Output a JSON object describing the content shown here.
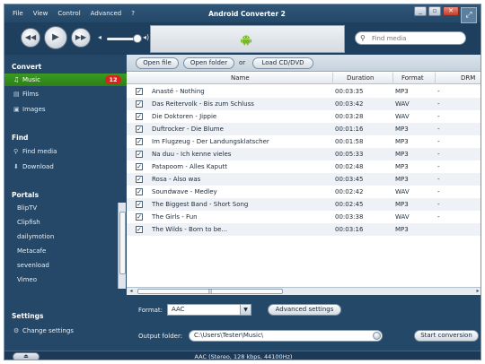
{
  "menu": [
    "File",
    "View",
    "Control",
    "Advanced",
    "?"
  ],
  "app_title": "Android Converter 2",
  "window_buttons": {
    "minimize": "_",
    "restore": "▫",
    "close": "✕",
    "expand": "⤢"
  },
  "player": {
    "rewind": "◀◀",
    "play": "▶",
    "forward": "▶▶",
    "volume_low": "◂",
    "volume_high": "◂))"
  },
  "search": {
    "placeholder": "Find media",
    "value": ""
  },
  "sidebar": {
    "convert_title": "Convert",
    "convert_items": [
      {
        "label": "Music",
        "icon": "music-note-icon",
        "badge": "12",
        "active": true
      },
      {
        "label": "Films",
        "icon": "film-icon"
      },
      {
        "label": "Images",
        "icon": "image-icon"
      }
    ],
    "find_title": "Find",
    "find_items": [
      {
        "label": "Find media",
        "icon": "find-media-icon"
      },
      {
        "label": "Download",
        "icon": "download-icon"
      }
    ],
    "portals_title": "Portals",
    "portals": [
      "BlipTV",
      "Clipfish",
      "dailymotion",
      "Metacafe",
      "sevenload",
      "Vimeo"
    ],
    "settings_title": "Settings",
    "settings_items": [
      {
        "label": "Change settings",
        "icon": "settings-icon"
      }
    ]
  },
  "toolbar": {
    "open_file": "Open file",
    "open_folder": "Open folder",
    "or": "or",
    "load_cd": "Load CD/DVD"
  },
  "table": {
    "columns": [
      "Name",
      "Duration",
      "Format",
      "DRM"
    ],
    "rows": [
      {
        "name": "Anasté - Nothing",
        "duration": "00:03:35",
        "format": "MP3",
        "drm": "-"
      },
      {
        "name": "Das Reitervolk - Bis zum Schluss",
        "duration": "00:03:42",
        "format": "WAV",
        "drm": "-"
      },
      {
        "name": "Die Doktoren - Jippie",
        "duration": "00:03:28",
        "format": "WAV",
        "drm": "-"
      },
      {
        "name": "Duftrocker - Die Blume",
        "duration": "00:01:16",
        "format": "MP3",
        "drm": "-"
      },
      {
        "name": "Im Flugzeug - Der Landungsklatscher",
        "duration": "00:01:58",
        "format": "MP3",
        "drm": "-"
      },
      {
        "name": "Na duu - Ich kenne vieles",
        "duration": "00:05:33",
        "format": "MP3",
        "drm": "-"
      },
      {
        "name": "Patapoom - Alles Kaputt",
        "duration": "00:02:48",
        "format": "MP3",
        "drm": "-"
      },
      {
        "name": "Rosa - Also was",
        "duration": "00:03:45",
        "format": "MP3",
        "drm": "-"
      },
      {
        "name": "Soundwave - Medley",
        "duration": "00:02:42",
        "format": "WAV",
        "drm": "-"
      },
      {
        "name": "The Biggest Band - Short Song",
        "duration": "00:02:45",
        "format": "MP3",
        "drm": "-"
      },
      {
        "name": "The Girls - Fun",
        "duration": "00:03:38",
        "format": "WAV",
        "drm": "-"
      },
      {
        "name": "The Wilds - Born to be...",
        "duration": "00:03:16",
        "format": "MP3",
        "drm": ""
      }
    ]
  },
  "output": {
    "format_label": "Format:",
    "format_value": "AAC",
    "advanced_settings": "Advanced settings",
    "folder_label": "Output folder:",
    "folder_value": "C:\\Users\\Tester\\Music\\",
    "start_conversion": "Start conversion"
  },
  "status": {
    "text": "AAC (Stereo, 128 kbps, 44100Hz)",
    "eject": "⏏"
  },
  "colors": {
    "accent_green": "#3a9b22",
    "badge_red": "#d8231f",
    "panel_blue": "#254869"
  }
}
